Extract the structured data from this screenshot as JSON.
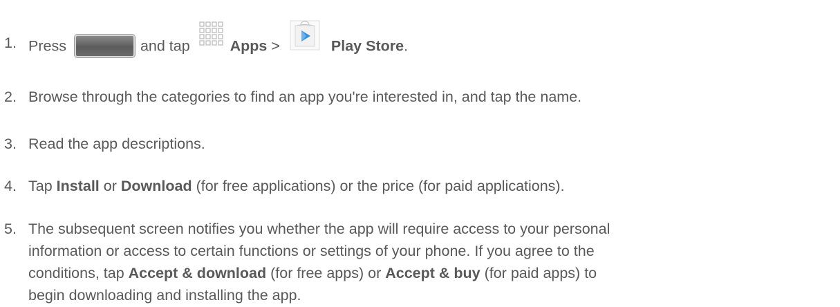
{
  "steps": [
    {
      "number": "1.",
      "parts": {
        "press": "Press",
        "and_tap": "and tap",
        "apps": "Apps",
        "sep": ">",
        "play_store": "Play Store",
        "end": "."
      },
      "icons": [
        "home-button-icon",
        "apps-grid-icon",
        "play-store-icon"
      ]
    },
    {
      "number": "2.",
      "text": "Browse through the categories to find an app you're interested in, and tap the name."
    },
    {
      "number": "3.",
      "text": "Read the app descriptions."
    },
    {
      "number": "4.",
      "parts": {
        "tap": "Tap",
        "install": "Install",
        "or": "or",
        "download": "Download",
        "rest": "(for free applications) or the price (for paid applications)."
      }
    },
    {
      "number": "5.",
      "parts": {
        "line1": "The subsequent screen notifies you whether the app will require access to your personal",
        "line2": "information or access to certain functions or settings of your phone. If you agree to the",
        "line3_start": "conditions, tap",
        "accept_download": "Accept & download",
        "line3_mid": "(for free apps) or",
        "accept_buy": "Accept & buy",
        "line3_end": "(for paid apps) to",
        "line4": "begin downloading and installing the app."
      }
    }
  ],
  "colors": {
    "text": "#595959",
    "home_button": "#6c6c6c",
    "play_triangle": "#3b8fd9"
  }
}
